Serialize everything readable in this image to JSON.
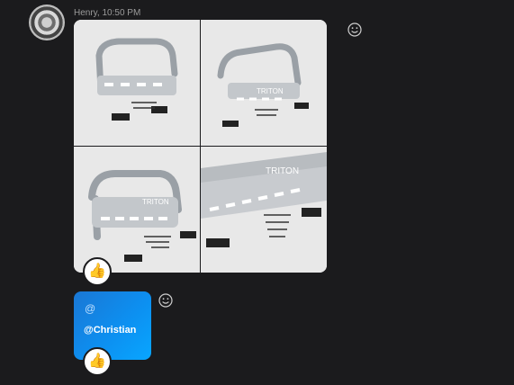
{
  "message": {
    "author": "Henry",
    "time": "10:50 PM",
    "meta_text": "Henry, 10:50 PM",
    "images": [
      {
        "alt": "bull bar product photo 1",
        "logo": ""
      },
      {
        "alt": "bull bar product photo 2",
        "logo": "TRITON"
      },
      {
        "alt": "bull bar product photo 3",
        "logo": "TRITON"
      },
      {
        "alt": "bull bar product photo 4",
        "logo": "TRITON"
      }
    ],
    "reaction": "👍"
  },
  "mention": {
    "symbol": "@",
    "name": "@Christian",
    "reaction": "👍"
  },
  "icons": {
    "avatar": "avatar-image",
    "react": "smiley-icon"
  }
}
